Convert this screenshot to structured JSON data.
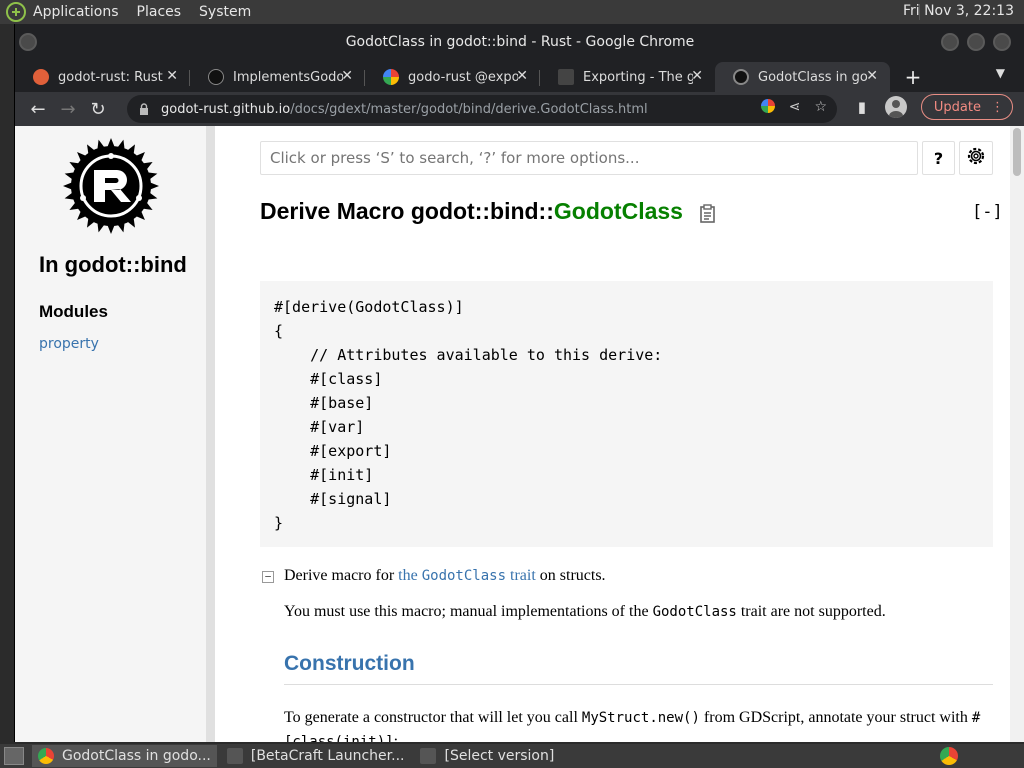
{
  "desktop": {
    "menus": [
      "Applications",
      "Places",
      "System"
    ],
    "clock": "Fri Nov  3, 22:13"
  },
  "window": {
    "title": "GodotClass in godot::bind - Rust - Google Chrome"
  },
  "tabs": [
    {
      "label": "godot-rust: Rust bi",
      "active": false
    },
    {
      "label": "ImplementsGodotT",
      "active": false
    },
    {
      "label": "godo-rust @export",
      "active": false
    },
    {
      "label": "Exporting - The gd",
      "active": false
    },
    {
      "label": "GodotClass in godo",
      "active": true
    }
  ],
  "address": {
    "host": "godot-rust.github.io",
    "path": "/docs/gdext/master/godot/bind/derive.GodotClass.html",
    "update_label": "Update"
  },
  "sidebar": {
    "title": "In godot::bind",
    "section": "Modules",
    "link": "property"
  },
  "search": {
    "placeholder": "Click or press ‘S’ to search, ‘?’ for more options...",
    "help_label": "?"
  },
  "heading": {
    "prefix": "Derive Macro godot::bind::",
    "name": "GodotClass",
    "collapse_label": "[-]"
  },
  "code": "#[derive(GodotClass)]\n{\n    // Attributes available to this derive:\n    #[class]\n    #[base]\n    #[var]\n    #[export]\n    #[init]\n    #[signal]\n}",
  "doc": {
    "toggle": "−",
    "line1_a": "Derive macro for ",
    "line1_link_a": "the ",
    "line1_link_code": "GodotClass",
    "line1_link_b": " trait",
    "line1_b": " on structs.",
    "para_a": "You must use this macro; manual implementations of the ",
    "para_code": "GodotClass",
    "para_b": " trait are not supported.",
    "section": "Construction",
    "para2_a": "To generate a constructor that will let you call ",
    "para2_code1": "MyStruct.new()",
    "para2_b": " from GDScript, annotate your struct with ",
    "para2_code2": "#[class(init)]",
    "para2_c": ":"
  },
  "taskbar": [
    {
      "label": "GodotClass in godo...",
      "active": true
    },
    {
      "label": "[BetaCraft Launcher...",
      "active": false
    },
    {
      "label": "[Select version]",
      "active": false
    }
  ]
}
